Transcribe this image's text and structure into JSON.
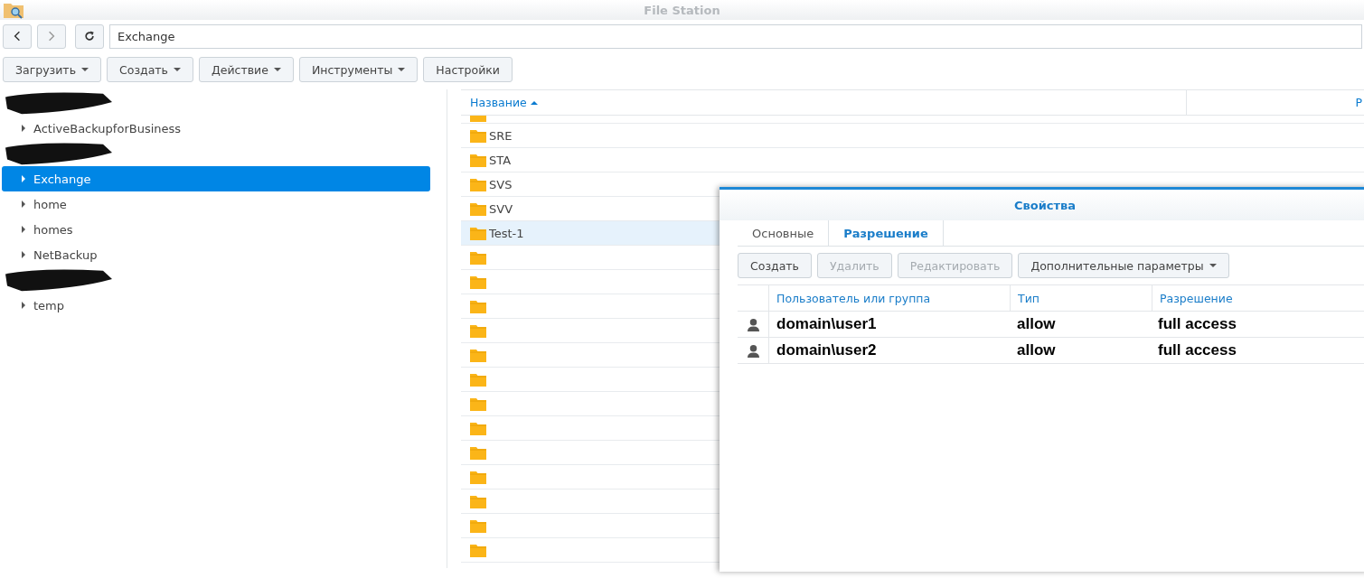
{
  "window": {
    "title": "File Station"
  },
  "nav": {
    "path": "Exchange"
  },
  "toolbar": [
    {
      "label": "Загрузить",
      "dropdown": true
    },
    {
      "label": "Создать",
      "dropdown": true
    },
    {
      "label": "Действие",
      "dropdown": true
    },
    {
      "label": "Инструменты",
      "dropdown": true
    },
    {
      "label": "Настройки",
      "dropdown": false
    }
  ],
  "tree": [
    {
      "kind": "redacted"
    },
    {
      "kind": "folder",
      "label": "ActiveBackupforBusiness",
      "selected": false
    },
    {
      "kind": "redacted"
    },
    {
      "kind": "folder",
      "label": "Exchange",
      "selected": true
    },
    {
      "kind": "folder",
      "label": "home",
      "selected": false
    },
    {
      "kind": "folder",
      "label": "homes",
      "selected": false
    },
    {
      "kind": "folder",
      "label": "NetBackup",
      "selected": false
    },
    {
      "kind": "redacted"
    },
    {
      "kind": "folder",
      "label": "temp",
      "selected": false
    }
  ],
  "files": {
    "columns": [
      "Название",
      "Р"
    ],
    "sort_ascending": true,
    "rows": [
      {
        "name": "SRE",
        "selected": false
      },
      {
        "name": "STA",
        "selected": false
      },
      {
        "name": "SVS",
        "selected": false
      },
      {
        "name": "SVV",
        "selected": false
      },
      {
        "name": "Test-1",
        "selected": true
      },
      {
        "selected": false
      },
      {
        "selected": false
      },
      {
        "selected": false
      },
      {
        "selected": false
      },
      {
        "selected": false
      },
      {
        "selected": false
      },
      {
        "selected": false
      },
      {
        "selected": false
      },
      {
        "selected": false
      },
      {
        "selected": false
      },
      {
        "selected": false
      },
      {
        "selected": false
      },
      {
        "selected": false
      }
    ]
  },
  "dialog": {
    "title": "Свойства",
    "tabs": [
      {
        "label": "Основные",
        "selected": false
      },
      {
        "label": "Разрешение",
        "selected": true
      }
    ],
    "buttons": [
      {
        "label": "Создать",
        "disabled": false,
        "dropdown": false
      },
      {
        "label": "Удалить",
        "disabled": true,
        "dropdown": false
      },
      {
        "label": "Редактировать",
        "disabled": true,
        "dropdown": false
      },
      {
        "label": "Дополнительные параметры",
        "disabled": false,
        "dropdown": true
      }
    ],
    "columns": [
      "Пользователь или группа",
      "Тип",
      "Разрешение"
    ],
    "rows": [
      {
        "user": "domain\\user1",
        "type": "allow",
        "permission": "full access"
      },
      {
        "user": "domain\\user2",
        "type": "allow",
        "permission": "full access"
      }
    ]
  }
}
